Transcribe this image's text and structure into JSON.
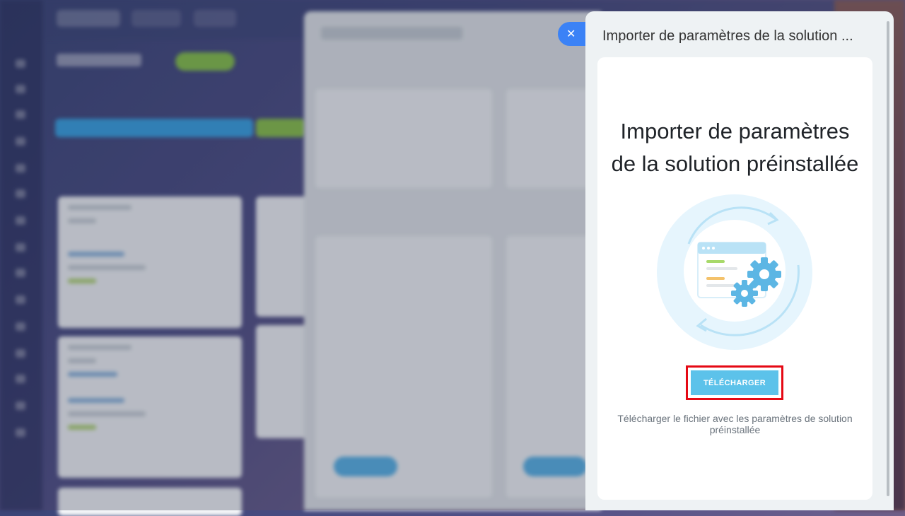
{
  "slider": {
    "title": "Importer de paramètres de la solution ...",
    "headline_line1": "Importer de paramètres",
    "headline_line2": "de la solution préinstallée",
    "download_label": "TÉLÉCHARGER",
    "description": "Télécharger le fichier avec les paramètres de solution préinstallée"
  },
  "close_icon": "close-icon",
  "colors": {
    "accent_button": "#5cc2ea",
    "close_button": "#3b82f6",
    "highlight_border": "#e50914"
  }
}
